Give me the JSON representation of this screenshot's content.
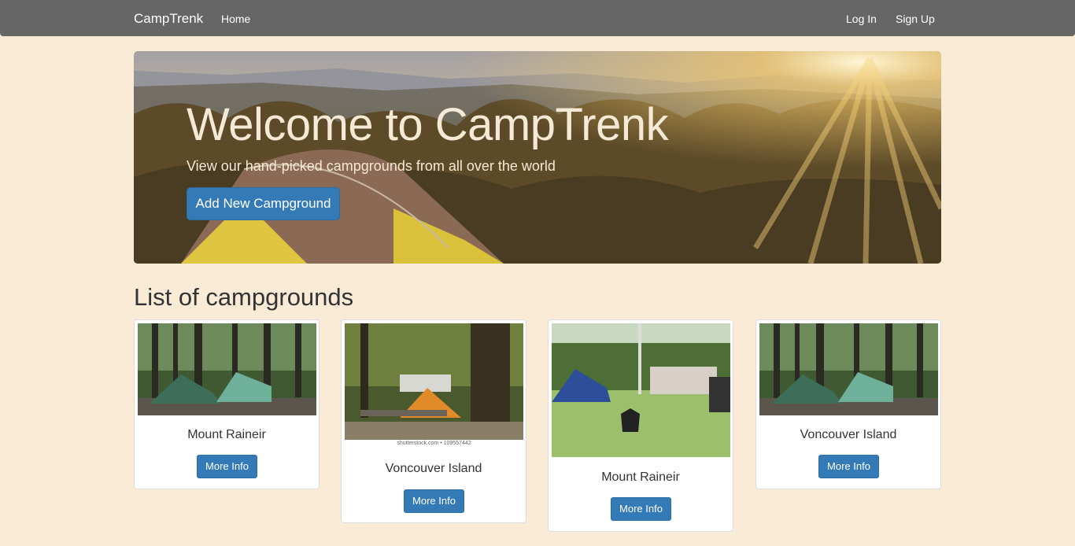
{
  "navbar": {
    "brand": "CampTrenk",
    "home": "Home",
    "login": "Log In",
    "signup": "Sign Up"
  },
  "hero": {
    "title": "Welcome to CampTrenk",
    "subtitle": "View our hand-picked campgrounds from all over the world",
    "button": "Add New Campground"
  },
  "list": {
    "title": "List of campgrounds",
    "cards": [
      {
        "name": "Mount Raineir",
        "button": "More Info"
      },
      {
        "name": "Voncouver Island",
        "button": "More Info",
        "caption": "shutterstock.com • 109557442"
      },
      {
        "name": "Mount Raineir",
        "button": "More Info"
      },
      {
        "name": "Voncouver Island",
        "button": "More Info"
      }
    ]
  },
  "colors": {
    "background": "#faebd7",
    "navbar": "#666666",
    "primary": "#337ab7",
    "hero_text": "#f6ead6"
  }
}
